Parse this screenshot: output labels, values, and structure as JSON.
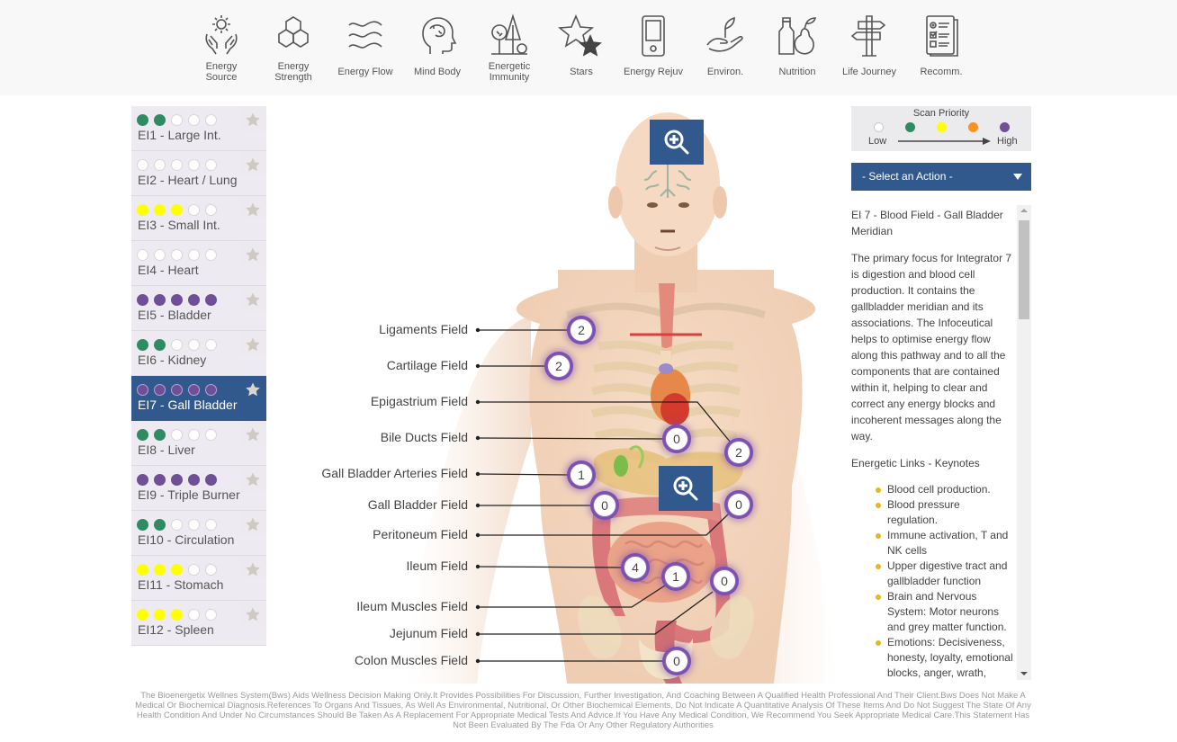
{
  "nav": [
    {
      "label": "Energy Source",
      "lines": [
        "Energy",
        "Source"
      ],
      "icon": "hands-sun-icon"
    },
    {
      "label": "Energy Strength",
      "lines": [
        "Energy",
        "Strength"
      ],
      "icon": "hexagons-icon"
    },
    {
      "label": "Energy Flow",
      "lines": [
        "Energy Flow"
      ],
      "icon": "waves-icon"
    },
    {
      "label": "Mind Body",
      "lines": [
        "Mind Body"
      ],
      "icon": "head-brain-icon"
    },
    {
      "label": "Energetic Immunity",
      "lines": [
        "Energetic",
        "Immunity"
      ],
      "icon": "trees-icon"
    },
    {
      "label": "Stars",
      "lines": [
        "Stars"
      ],
      "icon": "stars-icon"
    },
    {
      "label": "Energy Rejuv",
      "lines": [
        "Energy Rejuv"
      ],
      "icon": "device-icon"
    },
    {
      "label": "Environ.",
      "lines": [
        "Environ."
      ],
      "icon": "hand-sprout-icon"
    },
    {
      "label": "Nutrition",
      "lines": [
        "Nutrition"
      ],
      "icon": "bottle-pear-icon"
    },
    {
      "label": "Life Journey",
      "lines": [
        "Life Journey"
      ],
      "icon": "signpost-icon"
    },
    {
      "label": "Recomm.",
      "lines": [
        "Recomm."
      ],
      "icon": "checklist-icon"
    }
  ],
  "priority_colors": {
    "low": "#ffffff",
    "green": "#2e8b62",
    "yellow": "#ffff00",
    "orange": "#f7931e",
    "purple": "#6f4f96"
  },
  "integrators": [
    {
      "label": "EI1 - Large Int.",
      "dots": [
        "green",
        "green",
        "low",
        "low",
        "low"
      ],
      "active": false
    },
    {
      "label": "EI2 - Heart / Lung",
      "dots": [
        "low",
        "low",
        "low",
        "low",
        "low"
      ],
      "active": false
    },
    {
      "label": "EI3 - Small Int.",
      "dots": [
        "yellow",
        "yellow",
        "yellow",
        "low",
        "low"
      ],
      "active": false
    },
    {
      "label": "EI4 - Heart",
      "dots": [
        "low",
        "low",
        "low",
        "low",
        "low"
      ],
      "active": false
    },
    {
      "label": "EI5 - Bladder",
      "dots": [
        "purple",
        "purple",
        "purple",
        "purple",
        "purple"
      ],
      "active": false
    },
    {
      "label": "EI6 - Kidney",
      "dots": [
        "green",
        "green",
        "low",
        "low",
        "low"
      ],
      "active": false
    },
    {
      "label": "EI7 - Gall Bladder",
      "dots": [
        "purple",
        "purple",
        "purple",
        "purple",
        "purple"
      ],
      "active": true
    },
    {
      "label": "EI8 - Liver",
      "dots": [
        "green",
        "green",
        "low",
        "low",
        "low"
      ],
      "active": false
    },
    {
      "label": "EI9 - Triple Burner",
      "dots": [
        "purple",
        "purple",
        "purple",
        "purple",
        "purple"
      ],
      "active": false
    },
    {
      "label": "EI10 - Circulation",
      "dots": [
        "green",
        "green",
        "low",
        "low",
        "low"
      ],
      "active": false
    },
    {
      "label": "EI11 - Stomach",
      "dots": [
        "yellow",
        "yellow",
        "yellow",
        "low",
        "low"
      ],
      "active": false
    },
    {
      "label": "EI12 - Spleen",
      "dots": [
        "yellow",
        "yellow",
        "yellow",
        "low",
        "low"
      ],
      "active": false
    }
  ],
  "fields": [
    {
      "label": "Ligaments Field",
      "value": "2"
    },
    {
      "label": "Cartilage Field",
      "value": "2"
    },
    {
      "label": "Epigastrium Field",
      "value": "2"
    },
    {
      "label": "Bile Ducts Field",
      "value": "0"
    },
    {
      "label": "Gall Bladder Arteries Field",
      "value": "1"
    },
    {
      "label": "Gall Bladder Field",
      "value": "0"
    },
    {
      "label": "Peritoneum Field",
      "value": "0"
    },
    {
      "label": "Ileum Field",
      "value": "4"
    },
    {
      "label": "Ileum Muscles Field",
      "value": "1"
    },
    {
      "label": "Jejunum Field",
      "value": "0"
    },
    {
      "label": "Colon Muscles Field",
      "value": "0"
    }
  ],
  "legend": {
    "title": "Scan Priority",
    "low": "Low",
    "high": "High",
    "colors": [
      "#ffffff",
      "#2e8b62",
      "#ffff00",
      "#f7931e",
      "#6f4f96"
    ]
  },
  "action_select": {
    "selected": "- Select an Action -"
  },
  "info": {
    "title": "EI 7 - Blood Field - Gall Bladder Meridian",
    "description": "The primary focus for Integrator 7 is digestion and blood cell production. It contains the gallbladder meridian and its associations. The Infoceutical helps to optimise energy flow along this pathway and to all the components that are contained within it, helping to clear and correct any energy blocks and incoherent messages along the way.",
    "links_heading": "Energetic Links - Keynotes",
    "keynotes": [
      "Blood cell production.",
      "Blood pressure regulation.",
      "Immune activation, T and NK cells",
      "Upper digestive tract and gallbladder function",
      "Brain and Nervous System: Motor neurons and grey matter function.",
      "Emotions: Decisiveness, honesty, loyalty, emotional blocks, anger, wrath, bitterness."
    ]
  },
  "disclaimer": "The Bioenergetix Wellnes System(Bws) Aids Wellness Decision Making Only.It Provides Possibilities For Discussion, Further Investigation, And Coaching Between A Qualified Health Professional And Their Client.Bws Does Not Make A Medical Or Biochemical Diagnosis.References To Organs And Tissues, As Well As Environmental, Nutritional, Or Other Biochemical Elements, Do Not Indicate A Quantitative Analysis Of These Items And Do Not Suggest The State Of Any Health Condition And Under No Circumstances Should Be Taken As A Replacement For Appropriate Medical Tests And Advice.If You Have Any Medical Condition, We Recommend You Seek Appropriate Medical Care.This Statement Has Not Been Evaluated By The Fda Or Any Other Regulatory Authorities"
}
